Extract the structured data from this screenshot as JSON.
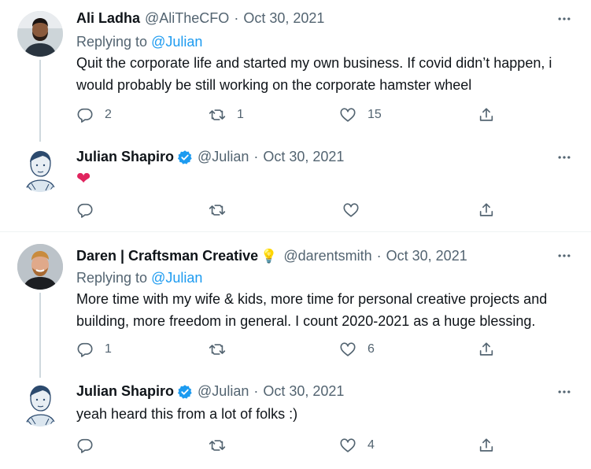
{
  "colors": {
    "link": "#1d9bf0",
    "muted": "#536471",
    "verified": "#1d9bf0",
    "heart": "#e0245e"
  },
  "tweets": [
    {
      "name": "Ali Ladha",
      "handle": "@AliTheCFO",
      "date": "Oct 30, 2021",
      "replying_label": "Replying to",
      "replying_to": "@Julian",
      "text": "Quit the corporate life and started my own business. If covid didn’t happen, i would probably be still working on the corporate hamster wheel",
      "reply_count": "2",
      "retweet_count": "1",
      "like_count": "15"
    },
    {
      "name": "Julian Shapiro",
      "verified": true,
      "handle": "@Julian",
      "date": "Oct 30, 2021",
      "text": "❤",
      "reply_count": "",
      "retweet_count": "",
      "like_count": ""
    },
    {
      "name": "Daren | Craftsman Creative",
      "emoji": "💡",
      "handle": "@darentsmith",
      "date": "Oct 30, 2021",
      "replying_label": "Replying to",
      "replying_to": "@Julian",
      "text": "More time with my wife & kids, more time for personal creative projects and building, more freedom in general. I count 2020-2021 as a huge blessing.",
      "reply_count": "1",
      "retweet_count": "",
      "like_count": "6"
    },
    {
      "name": "Julian Shapiro",
      "verified": true,
      "handle": "@Julian",
      "date": "Oct 30, 2021",
      "text": "yeah heard this from a lot of folks :)",
      "reply_count": "",
      "retweet_count": "",
      "like_count": "4"
    }
  ]
}
